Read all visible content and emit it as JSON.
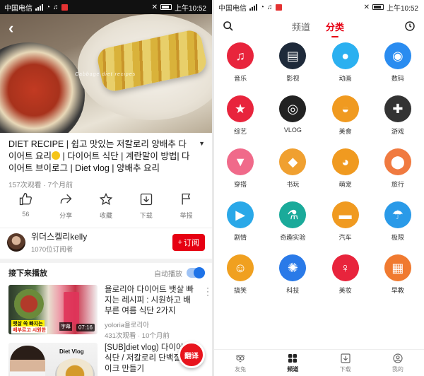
{
  "status_bar": {
    "carrier": "中国电信",
    "time": "上午10:52"
  },
  "video": {
    "watermark": "Cabbage diet recipes",
    "title_prefix": "DIET RECIPE | 쉽고 맛있는 저칼로리 양배추 다이어트 요리",
    "title_suffix": " | 다이어트 식단 | 계란말이 방법| 다이어트 브이로그 | Diet vlog | 양배추 요리",
    "meta": "157次观看 · 7个月前"
  },
  "actions": [
    {
      "id": "like",
      "label": "56",
      "icon": "thumbs-up-icon"
    },
    {
      "id": "share",
      "label": "分享",
      "icon": "share-icon"
    },
    {
      "id": "favorite",
      "label": "收藏",
      "icon": "star-icon"
    },
    {
      "id": "download",
      "label": "下载",
      "icon": "download-icon"
    },
    {
      "id": "report",
      "label": "举报",
      "icon": "flag-icon"
    }
  ],
  "channel": {
    "name": "위더스켈리kelly",
    "subscribers": "1070位订阅者",
    "subscribe_label": "订阅"
  },
  "up_next": {
    "label": "接下来播放",
    "autoplay_label": "自动播放",
    "autoplay_on": true
  },
  "recommendations": [
    {
      "title": "욜로리아 다이어트 뱃살 빠지는 레시피 : 시원하고 배부른 여름 식단 2가지",
      "channel": "yoloria욜로리아",
      "meta": "431次观看 · 10个月前",
      "duration": "07:16",
      "caption_line1": "뱃살 쏙 빠지는",
      "caption_line2": "배부르고 시원한",
      "subtitle_badge": "字幕"
    },
    {
      "title": "[SUB]diet vlog) 다이어트 식단 / 저칼로리 단백질 케이크 만들기",
      "channel": "",
      "meta": "",
      "brand": "Diet Vlog"
    }
  ],
  "translate_button": "翻译",
  "right_nav": {
    "tabs": [
      "频道",
      "分类"
    ],
    "active_tab": 1
  },
  "categories": [
    {
      "label": "音乐",
      "icon": "music-note-icon",
      "color": "#e8243c"
    },
    {
      "label": "影视",
      "icon": "film-strip-icon",
      "color": "#1e2a3a"
    },
    {
      "label": "动画",
      "icon": "panda-icon",
      "color": "#2bb0f0"
    },
    {
      "label": "数码",
      "icon": "camera-icon",
      "color": "#2a8cf0"
    },
    {
      "label": "综艺",
      "icon": "star-badge-icon",
      "color": "#e8243c"
    },
    {
      "label": "VLOG",
      "icon": "camera-lens-icon",
      "color": "#222"
    },
    {
      "label": "美食",
      "icon": "noodle-bowl-icon",
      "color": "#f09a20"
    },
    {
      "label": "游戏",
      "icon": "gamepad-icon",
      "color": "#333"
    },
    {
      "label": "穿搭",
      "icon": "shirt-icon",
      "color": "#f06a8a"
    },
    {
      "label": "书玩",
      "icon": "diamond-icon",
      "color": "#f0a030"
    },
    {
      "label": "萌宠",
      "icon": "cat-icon",
      "color": "#f09a20"
    },
    {
      "label": "旅行",
      "icon": "map-pin-icon",
      "color": "#f07a40"
    },
    {
      "label": "剧情",
      "icon": "tv-icon",
      "color": "#2aa8e8"
    },
    {
      "label": "奇趣实验",
      "icon": "flask-icon",
      "color": "#1aaa9a"
    },
    {
      "label": "汽车",
      "icon": "car-icon",
      "color": "#f09a20"
    },
    {
      "label": "极限",
      "icon": "parachute-icon",
      "color": "#2a9ae8"
    },
    {
      "label": "搞笑",
      "icon": "laugh-face-icon",
      "color": "#f0a020"
    },
    {
      "label": "科技",
      "icon": "atom-icon",
      "color": "#2a7ae8"
    },
    {
      "label": "美妆",
      "icon": "woman-face-icon",
      "color": "#e8243c"
    },
    {
      "label": "早教",
      "icon": "abc-blocks-icon",
      "color": "#f07a30"
    }
  ],
  "bottom_nav": [
    {
      "label": "友兔",
      "icon": "owl-icon"
    },
    {
      "label": "频道",
      "icon": "grid-icon"
    },
    {
      "label": "下载",
      "icon": "download-icon"
    },
    {
      "label": "我的",
      "icon": "user-icon"
    }
  ],
  "bottom_nav_active": 1
}
